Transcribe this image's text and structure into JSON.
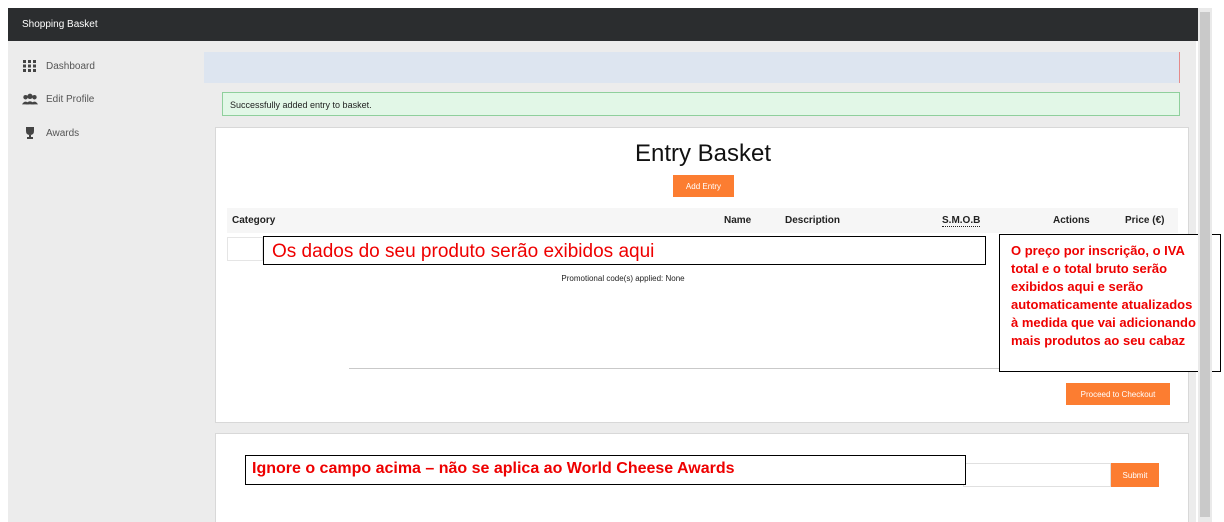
{
  "topbar": {
    "title": "Shopping Basket"
  },
  "sidebar": {
    "items": [
      {
        "label": "Dashboard",
        "icon": "grid-icon"
      },
      {
        "label": "Edit Profile",
        "icon": "users-icon"
      },
      {
        "label": "Awards",
        "icon": "trophy-icon"
      }
    ]
  },
  "alert": {
    "message": "Successfully added entry to basket."
  },
  "basket": {
    "title": "Entry Basket",
    "add_entry_label": "Add Entry",
    "columns": [
      "Category",
      "Name",
      "Description",
      "S.M.O.B",
      "Actions",
      "Price (€)"
    ],
    "promo_text": "Promotional code(s) applied: None",
    "checkout_label": "Proceed to Checkout"
  },
  "promo_form": {
    "submit_label": "Submit"
  },
  "annotations": {
    "product_data": "Os dados do seu produto serão exibidos aqui",
    "price_info": "O preço por inscrição, o IVA\ntotal e o total bruto serão\nexibidos aqui e serão\nautomaticamente atualizados\nà medida que vai adicionando\nmais produtos ao seu cabaz",
    "ignore_field": "Ignore o campo acima – não se aplica ao World Cheese Awards"
  },
  "colors": {
    "accent": "#fc7d31",
    "annotation_text": "#e00000",
    "topbar": "#2b2d2f"
  }
}
